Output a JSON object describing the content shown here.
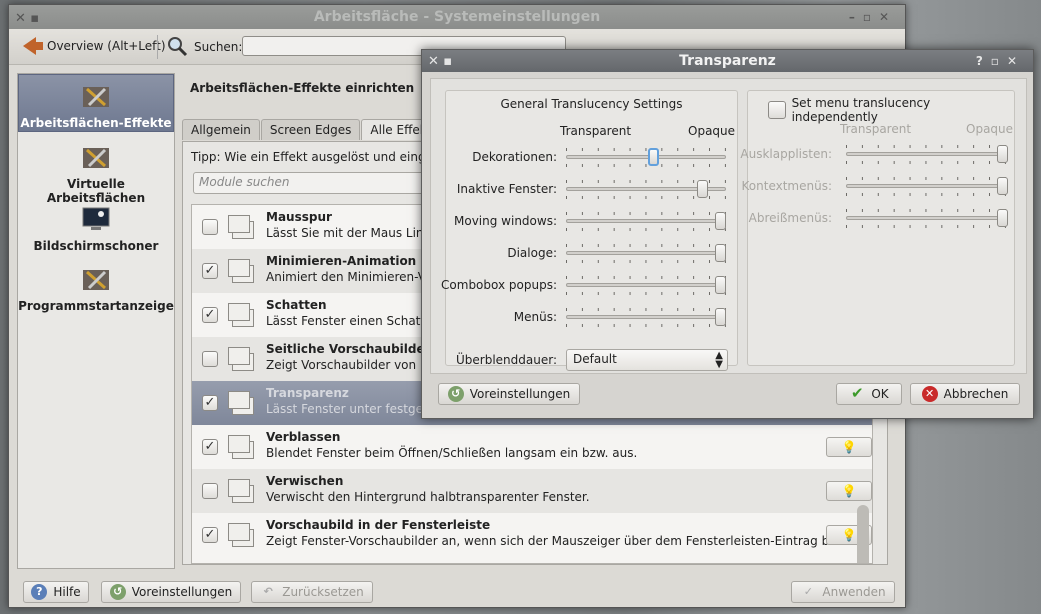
{
  "main": {
    "title": "Arbeitsfläche - Systemeinstellungen",
    "overview_label": "Overview (Alt+Left)",
    "search_label": "Suchen:",
    "page_heading": "Arbeitsflächen-Effekte einrichten",
    "sidebar": [
      {
        "label": "Arbeitsflächen-Effekte"
      },
      {
        "label": "Virtuelle Arbeitsflächen"
      },
      {
        "label": "Bildschirmschoner"
      },
      {
        "label": "Programmstartanzeige"
      }
    ],
    "tabs": [
      "Allgemein",
      "Screen Edges",
      "Alle Effekte"
    ],
    "tip": "Tipp: Wie ein Effekt ausgelöst und eingerich",
    "module_search_placeholder": "Module suchen",
    "effects": [
      {
        "name": "Mausspur",
        "desc": "Lässt Sie mit der Maus Linien",
        "checked": ""
      },
      {
        "name": "Minimieren-Animation",
        "desc": "Animiert den Minimieren-Vorg",
        "checked": "✓"
      },
      {
        "name": "Schatten",
        "desc": "Lässt Fenster einen Schatten",
        "checked": "✓"
      },
      {
        "name": "Seitliche Vorschaubilder",
        "desc": "Zeigt Vorschaubilder von Fens",
        "checked": ""
      },
      {
        "name": "Transparenz",
        "desc": "Lässt Fenster unter festgeleg",
        "checked": "✓"
      },
      {
        "name": "Verblassen",
        "desc": "Blendet Fenster beim Öffnen/Schließen langsam ein bzw. aus.",
        "checked": "✓"
      },
      {
        "name": "Verwischen",
        "desc": "Verwischt den Hintergrund halbtransparenter Fenster.",
        "checked": ""
      },
      {
        "name": "Vorschaubild in der Fensterleiste",
        "desc": "Zeigt Fenster-Vorschaubilder an, wenn sich der Mauszeiger über dem Fensterleisten-Eintrag befi...",
        "checked": "✓"
      }
    ],
    "buttons": {
      "help": "Hilfe",
      "defaults": "Voreinstellungen",
      "reset": "Zurücksetzen",
      "apply": "Anwenden"
    }
  },
  "dialog": {
    "title": "Transparenz",
    "general_group_title": "General Translucency Settings",
    "transparent_label": "Transparent",
    "opaque_label": "Opaque",
    "sliders": [
      {
        "label": "Dekorationen:",
        "value": 0.55
      },
      {
        "label": "Inaktive Fenster:",
        "value": 0.88
      },
      {
        "label": "Moving windows:",
        "value": 1.0
      },
      {
        "label": "Dialoge:",
        "value": 1.0
      },
      {
        "label": "Combobox popups:",
        "value": 1.0
      },
      {
        "label": "Menüs:",
        "value": 1.0
      }
    ],
    "fade_label": "Überblenddauer:",
    "fade_value": "Default",
    "menu_group_checkbox": "Set menu translucency independently",
    "menu_sliders": [
      {
        "label": "Ausklapplisten:",
        "value": 1.0
      },
      {
        "label": "Kontextmenüs:",
        "value": 1.0
      },
      {
        "label": "Abreißmenüs:",
        "value": 1.0
      }
    ],
    "buttons": {
      "defaults": "Voreinstellungen",
      "ok": "OK",
      "cancel": "Abbrechen"
    }
  }
}
